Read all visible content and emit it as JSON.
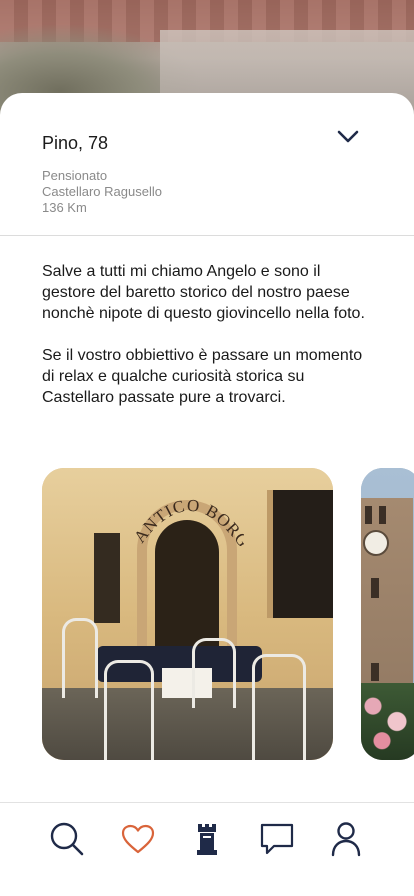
{
  "profile": {
    "name_age": "Pino, 78",
    "occupation": "Pensionato",
    "location": "Castellaro Ragusello",
    "distance": "136 Km"
  },
  "bio": {
    "paragraph_1": "Salve a tutti mi chiamo Angelo e sono il gestore del baretto storico del nostro paese nonchè nipote di questo giovincello nella foto.",
    "paragraph_2": "Se il vostro obbiettivo è passare un momento di relax e qualche curiosità storica su Castellaro passate pure a trovarci."
  },
  "photos": [
    {
      "name": "cafe-photo",
      "sign_text": "ANTICO BORGO"
    },
    {
      "name": "clock-tower-photo"
    }
  ],
  "icons": {
    "collapse": "chevron-down-icon",
    "search": "search-icon",
    "favorites": "heart-icon",
    "tower": "tower-icon",
    "messages": "chat-icon",
    "profile": "user-icon"
  },
  "colors": {
    "accent": "#d9643a",
    "nav_icon": "#1f2a48",
    "text": "#1a1a1a",
    "muted": "#8a8a8a"
  }
}
